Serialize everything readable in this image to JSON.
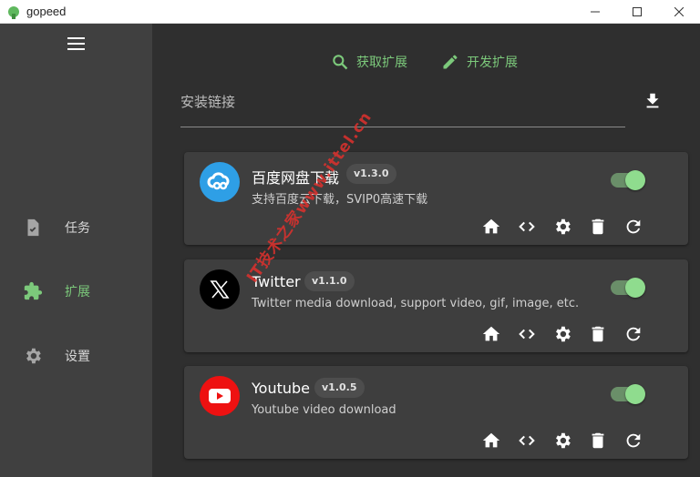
{
  "window": {
    "title": "gopeed",
    "controls": {
      "minimize": "minimize-icon",
      "maximize": "maximize-icon",
      "close": "close-icon"
    }
  },
  "sidebar": {
    "menu_icon": "hamburger-icon",
    "items": [
      {
        "label": "任务",
        "icon": "task-file-icon",
        "active": false
      },
      {
        "label": "扩展",
        "icon": "puzzle-icon",
        "active": true
      },
      {
        "label": "设置",
        "icon": "gear-icon",
        "active": false
      }
    ]
  },
  "main": {
    "fetch_extensions": "获取扩展",
    "develop_extensions": "开发扩展",
    "install_label": "安装链接",
    "download_icon": "download-icon",
    "extensions": [
      {
        "name": "百度网盘下载",
        "version": "v1.3.0",
        "description": "支持百度云下载，SVIP0高速下载",
        "icon": "baidu-cloud-icon",
        "enabled": true
      },
      {
        "name": "Twitter",
        "version": "v1.1.0",
        "description": "Twitter media download, support video, gif, image, etc.",
        "icon": "x-logo-icon",
        "enabled": true
      },
      {
        "name": "Youtube",
        "version": "v1.0.5",
        "description": "Youtube video download",
        "icon": "youtube-icon",
        "enabled": true
      }
    ],
    "card_actions": [
      "home-icon",
      "code-icon",
      "settings-icon",
      "delete-icon",
      "refresh-icon"
    ]
  },
  "watermark": "IT技术之家www.ittel.cn",
  "colors": {
    "accent": "#7cc97b",
    "background": "#2f2f2f",
    "sidebar": "#404040",
    "card": "#3e3e3e",
    "watermark": "#e0312d"
  }
}
